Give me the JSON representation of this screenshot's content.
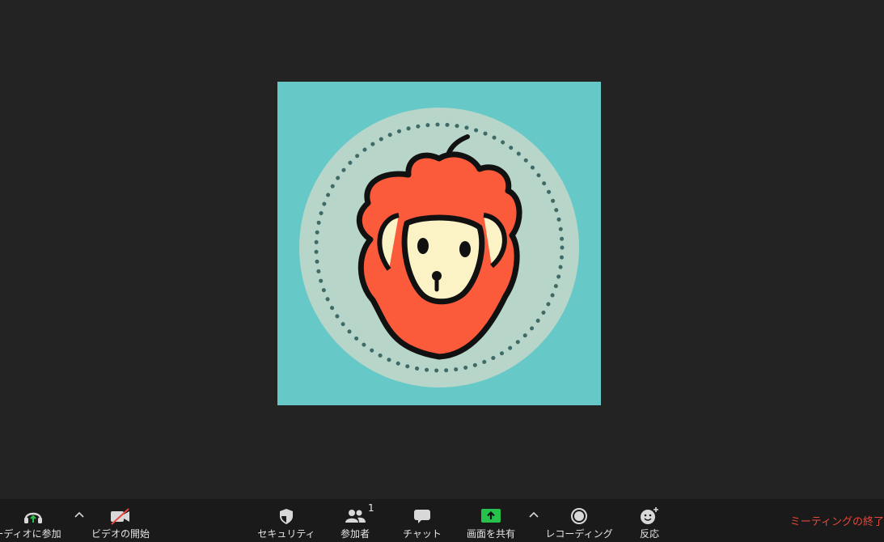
{
  "toolbar": {
    "audio_label": "ーディオに参加",
    "video_label": "ビデオの開始",
    "security_label": "セキュリティ",
    "participants_label": "参加者",
    "participants_count": "1",
    "chat_label": "チャット",
    "share_label": "画面を共有",
    "record_label": "レコーディング",
    "reactions_label": "反応",
    "end_label": "ミーティングの終了"
  },
  "colors": {
    "background": "#232323",
    "toolbar": "#1a1a1a",
    "avatar_bg": "#67c8c8",
    "avatar_ring": "#b7d6c9",
    "share_green": "#27c24c",
    "end_red": "#e8473d"
  },
  "icons": {
    "audio": "headphones-icon",
    "video": "video-off-icon",
    "security": "shield-icon",
    "participants": "people-icon",
    "chat": "chat-bubble-icon",
    "share": "share-screen-icon",
    "record": "record-icon",
    "reactions": "emoji-icon"
  }
}
